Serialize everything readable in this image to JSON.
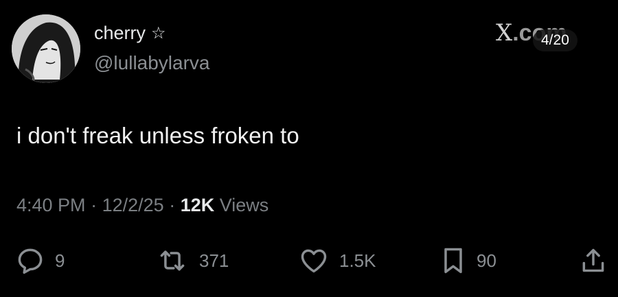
{
  "header": {
    "display_name": "cherry",
    "handle": "@lullabylarva",
    "badge_icon": "star-outline-icon"
  },
  "watermark": {
    "brand_mark": "X",
    "brand_suffix": ".com"
  },
  "counter": "4/20",
  "tweet": {
    "text": "i don't freak unless froken to"
  },
  "meta": {
    "time": "4:40 PM",
    "date": "12/2/25",
    "views_count": "12K",
    "views_label": "Views",
    "separator": "·"
  },
  "actions": {
    "replies": "9",
    "reposts": "371",
    "likes": "1.5K",
    "bookmarks": "90"
  },
  "colors": {
    "background": "#000000",
    "text": "#e7e9ea",
    "secondary": "#8b8f93"
  }
}
